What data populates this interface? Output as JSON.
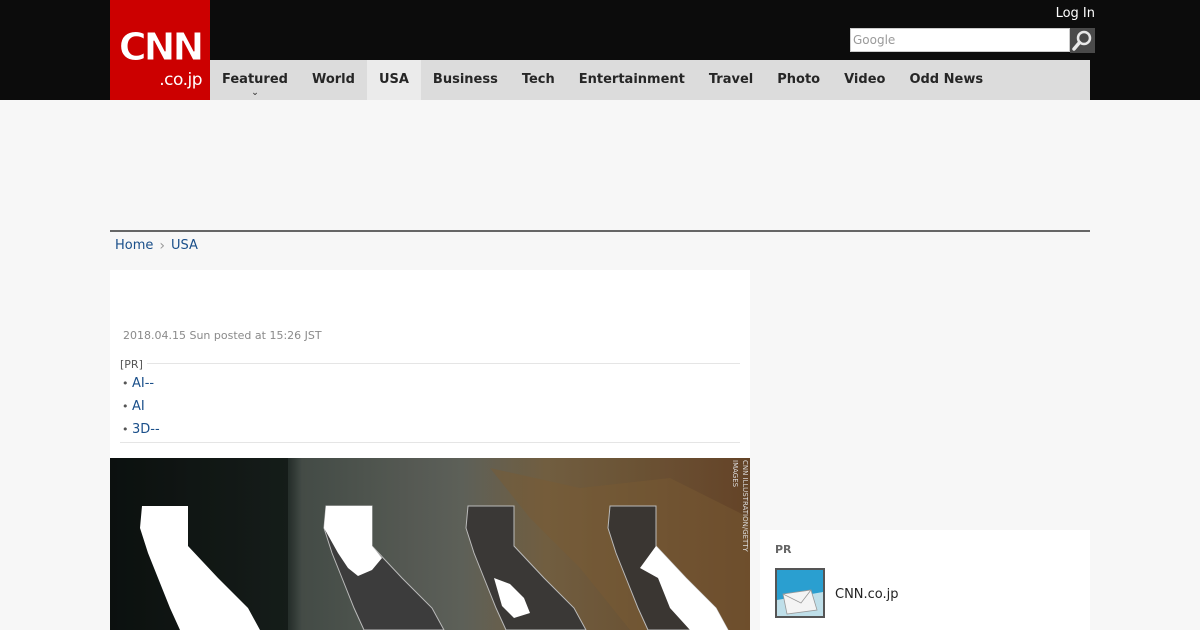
{
  "header": {
    "logo_main": "CNN",
    "logo_sub": ".co.jp",
    "login_label": "Log In",
    "search_placeholder": "Google",
    "search_icon": "magnifier-icon"
  },
  "nav": {
    "items": [
      {
        "label": "Featured",
        "dropdown": true
      },
      {
        "label": "World"
      },
      {
        "label": "USA",
        "active": true
      },
      {
        "label": "Business"
      },
      {
        "label": "Tech"
      },
      {
        "label": "Entertainment"
      },
      {
        "label": "Travel"
      },
      {
        "label": "Photo"
      },
      {
        "label": "Video"
      },
      {
        "label": "Odd News"
      }
    ]
  },
  "breadcrumb": {
    "home": "Home",
    "separator_icon": "chevron-right-icon",
    "current": "USA"
  },
  "article": {
    "timestamp": "2018.04.15 Sun posted at 15:26 JST",
    "pr_label": "[PR]",
    "pr_links": [
      "AI--",
      "AI",
      "3D--"
    ],
    "image_credit": "CNN ILLUSTRATION/GETTY IMAGES"
  },
  "sidebar": {
    "pr_label": "PR",
    "item_text": "CNN.co.jp",
    "item_icon": "mail-icon"
  },
  "colors": {
    "brand_red": "#cc0000",
    "header_bg": "#0c0c0c",
    "nav_bg": "#dcdcdc",
    "link": "#1a4f8a"
  }
}
